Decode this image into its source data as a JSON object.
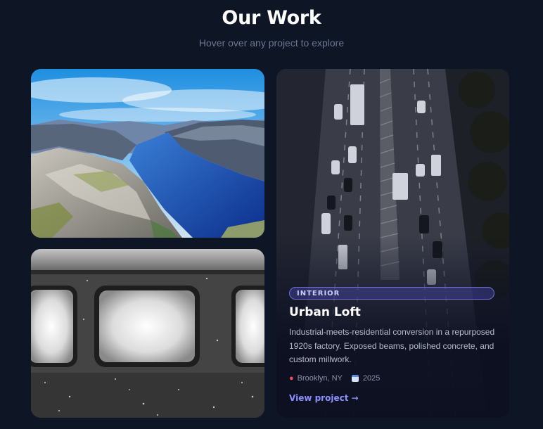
{
  "header": {
    "title": "Our Work",
    "subtitle": "Hover over any project to explore"
  },
  "projects": [
    {
      "image": "fjord-landscape-photo"
    },
    {
      "image": "train-window-snow-photo"
    },
    {
      "image": "highway-aerial-photo",
      "category": "INTERIOR",
      "title": "Urban Loft",
      "description": "Industrial-meets-residential conversion in a repurposed 1920s factory. Exposed beams, polished concrete, and custom millwork.",
      "location": "Brooklyn, NY",
      "year": "2025",
      "cta": "View project →",
      "location_icon": "pin-icon",
      "year_icon": "calendar-icon"
    }
  ],
  "colors": {
    "background": "#0e1525",
    "accent": "#8c8fff",
    "badge_border": "#6a6fd6"
  }
}
